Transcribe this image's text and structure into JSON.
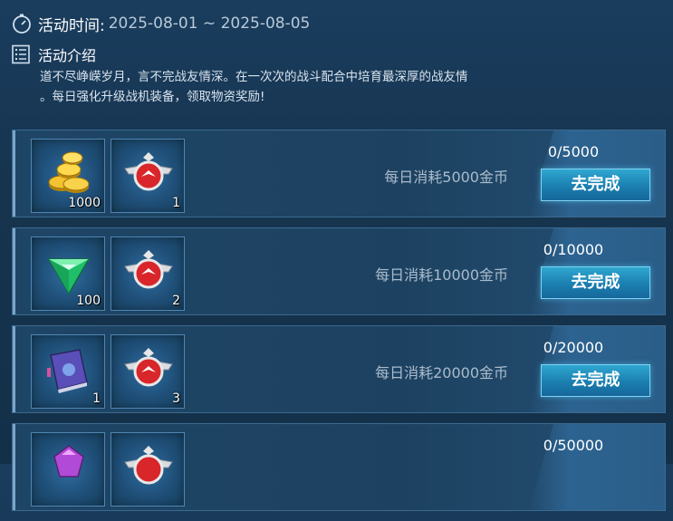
{
  "header": {
    "time_label": "活动时间:",
    "time_value": "2025-08-01 ~ 2025-08-05",
    "intro_title": "活动介绍",
    "intro_line1": "道不尽峥嵘岁月，言不完战友情深。在一次次的战斗配合中培育最深厚的战友情",
    "intro_line2": "。每日强化升级战机装备，领取物资奖励!"
  },
  "rows": [
    {
      "item1_icon": "gold-coins-icon",
      "item1_qty": "1000",
      "item2_icon": "wing-badge-icon",
      "item2_qty": "1",
      "task": "每日消耗5000金币",
      "progress": "0/5000",
      "button": "去完成"
    },
    {
      "item1_icon": "green-gem-icon",
      "item1_qty": "100",
      "item2_icon": "wing-badge-icon",
      "item2_qty": "2",
      "task": "每日消耗10000金币",
      "progress": "0/10000",
      "button": "去完成"
    },
    {
      "item1_icon": "purple-book-icon",
      "item1_qty": "1",
      "item2_icon": "wing-badge-icon",
      "item2_qty": "3",
      "task": "每日消耗20000金币",
      "progress": "0/20000",
      "button": "去完成"
    },
    {
      "item1_icon": "purple-crystal-icon",
      "item1_qty": "",
      "item2_icon": "wing-badge-icon",
      "item2_qty": "",
      "task": "",
      "progress": "0/50000",
      "button": ""
    }
  ],
  "colors": {
    "accent": "#2fa7d1",
    "panel": "#1f4566"
  }
}
